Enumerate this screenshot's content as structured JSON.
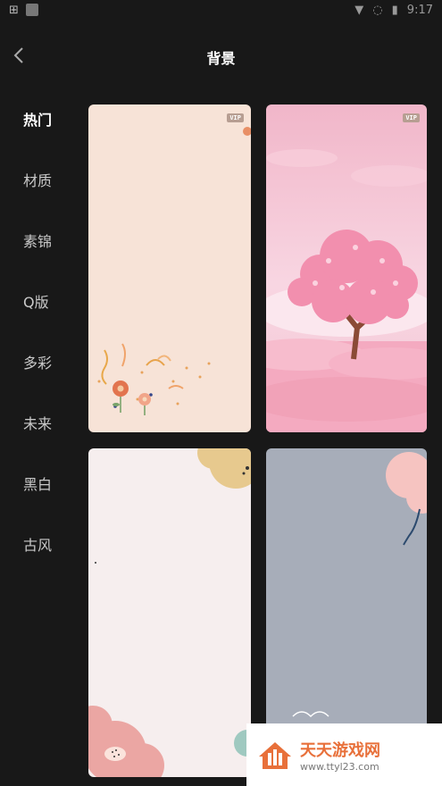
{
  "status_bar": {
    "time": "9:17"
  },
  "header": {
    "title": "背景"
  },
  "sidebar": {
    "items": [
      {
        "label": "热门",
        "active": true
      },
      {
        "label": "材质"
      },
      {
        "label": "素锦"
      },
      {
        "label": "Q版"
      },
      {
        "label": "多彩"
      },
      {
        "label": "未来"
      },
      {
        "label": "黑白"
      },
      {
        "label": "古风"
      }
    ]
  },
  "grid": {
    "cards": [
      {
        "name": "floral-confetti-background",
        "badge": "VIP"
      },
      {
        "name": "cherry-blossom-tree-background",
        "badge": "VIP"
      },
      {
        "name": "pastel-flowers-background"
      },
      {
        "name": "grey-blue-floral-background"
      }
    ]
  },
  "watermark": {
    "name": "天天游戏网",
    "url": "www.ttyl23.com"
  },
  "colors": {
    "background": "#181818",
    "accent": "#e8703a"
  }
}
